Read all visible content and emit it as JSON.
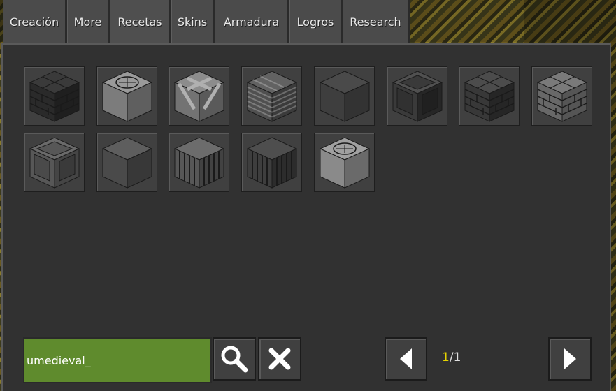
{
  "tabs": [
    {
      "label": "Creación"
    },
    {
      "label": "More"
    },
    {
      "label": "Recetas"
    },
    {
      "label": "Skins"
    },
    {
      "label": "Armadura"
    },
    {
      "label": "Logros"
    },
    {
      "label": "Research"
    }
  ],
  "items": [
    {
      "block": "dark-stone-bricks"
    },
    {
      "block": "engraved-stone"
    },
    {
      "block": "woven-stone"
    },
    {
      "block": "layered-stone"
    },
    {
      "block": "smooth-dark-stone"
    },
    {
      "block": "beveled-dark-stone"
    },
    {
      "block": "dark-brick-wall"
    },
    {
      "block": "light-stone-bricks"
    },
    {
      "block": "framed-stone"
    },
    {
      "block": "rough-stone"
    },
    {
      "block": "stone-pillar"
    },
    {
      "block": "cracked-pillar"
    },
    {
      "block": "carved-stone"
    }
  ],
  "search": {
    "value": "umedieval_"
  },
  "pagination": {
    "current": "1",
    "separator": "/",
    "total": "1"
  },
  "icons": {
    "search": "magnifier-icon",
    "clear": "x-icon",
    "prev": "arrow-left-icon",
    "next": "arrow-right-icon"
  }
}
